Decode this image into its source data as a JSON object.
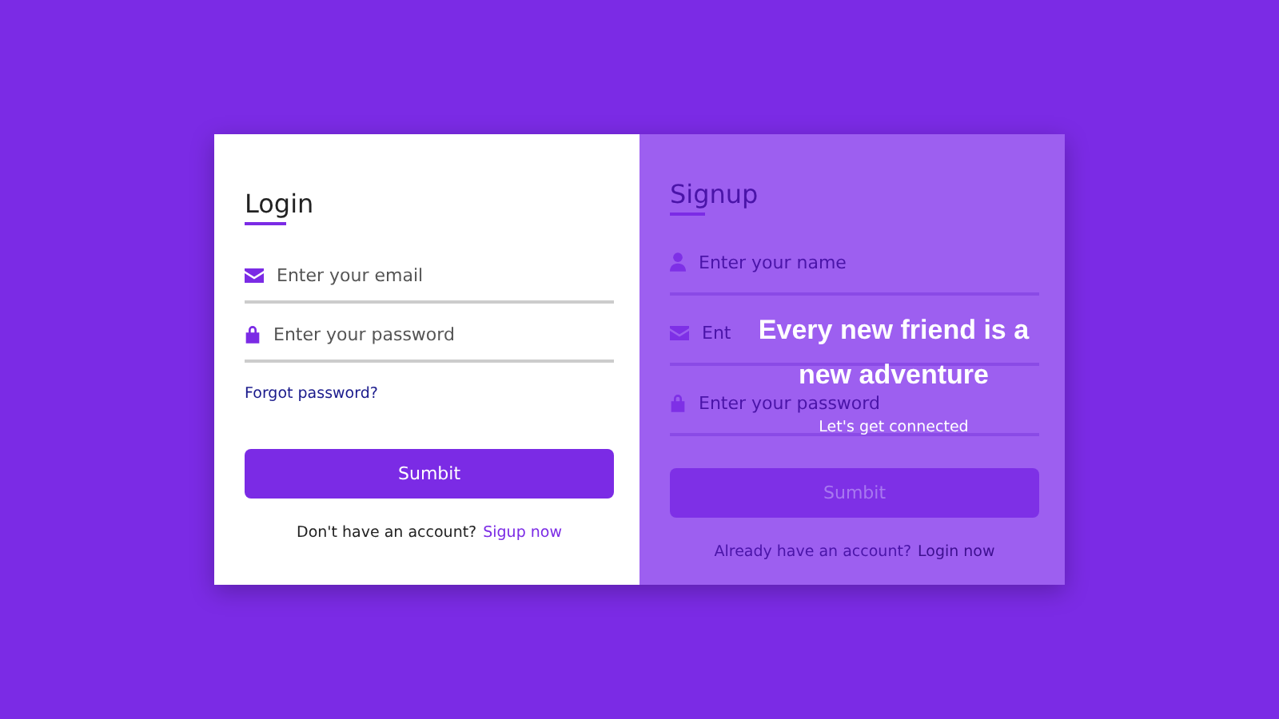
{
  "login": {
    "title": "Login",
    "fields": [
      {
        "kind": "email",
        "placeholder": "Enter your email"
      },
      {
        "kind": "password",
        "placeholder": "Enter your password"
      }
    ],
    "forgot_link": "Forgot password?",
    "submit": "Sumbit",
    "footer_text": "Don't have an account?",
    "footer_link": "Sigup now"
  },
  "signup": {
    "title": "Signup",
    "fields": [
      {
        "kind": "name",
        "placeholder": "Enter your name"
      },
      {
        "kind": "email",
        "placeholder": "Ent"
      },
      {
        "kind": "password",
        "placeholder": "Enter your password"
      }
    ],
    "submit": "Sumbit",
    "footer_text": "Already have an account?",
    "footer_link": "Login now"
  },
  "overlay": {
    "heading_lines": [
      "Every new friend is a",
      "new adventure"
    ],
    "subheading": "Let's get connected"
  }
}
